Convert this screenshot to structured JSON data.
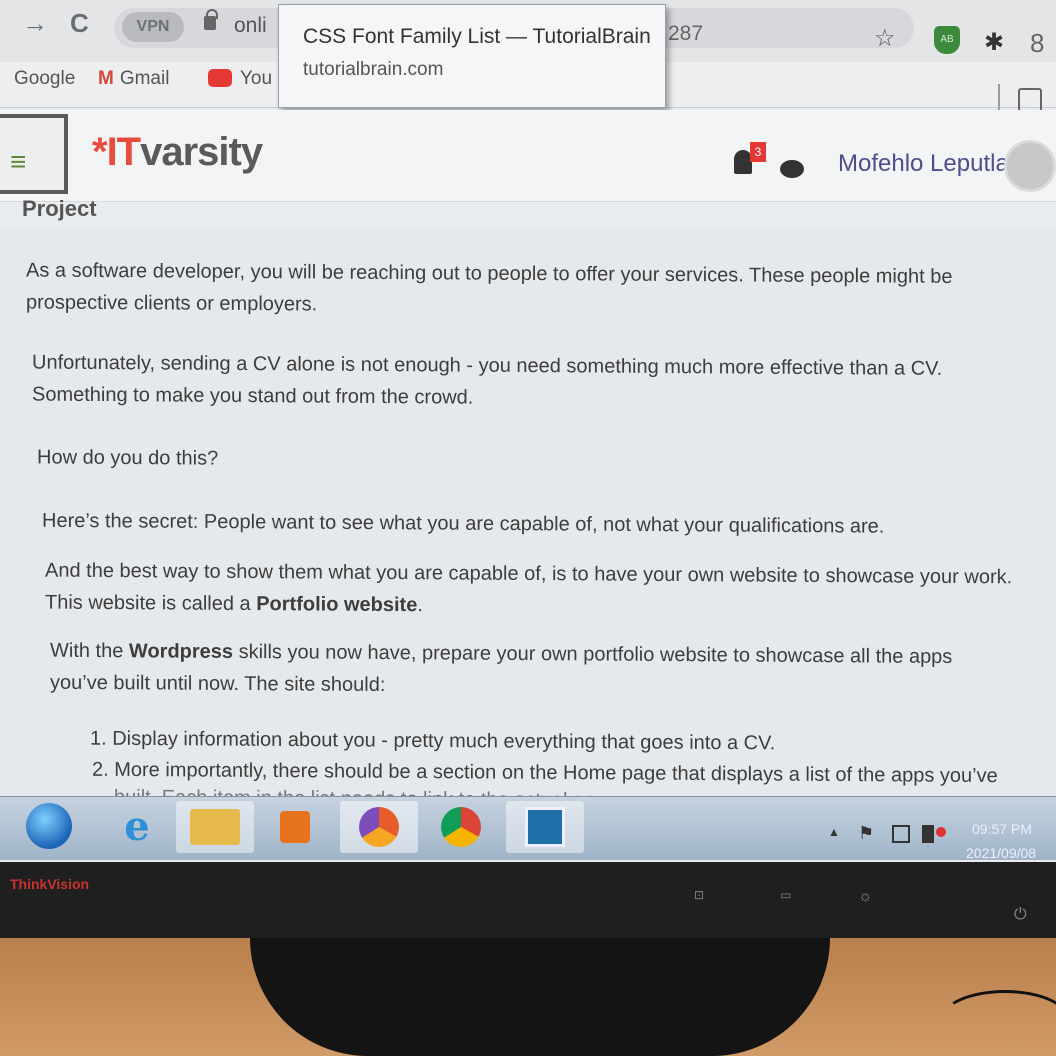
{
  "browser": {
    "vpn_label": "VPN",
    "url_start": "onli",
    "url_end": "287",
    "bookmarks": [
      {
        "label": "Google"
      },
      {
        "label": "Gmail",
        "glyph": "M"
      },
      {
        "label": "You"
      }
    ],
    "extension_badge": "AB"
  },
  "tooltip": {
    "title": "CSS Font Family List — TutorialBrain",
    "url": "tutorialbrain.com"
  },
  "site": {
    "logo_mark": "*IT",
    "logo_word": "varsity",
    "notification_count": "3",
    "user_name": "Mofehlo Leputla",
    "menu_glyph": "≡"
  },
  "page": {
    "title": "Project",
    "p1": "As a software developer, you will be reaching out to people to offer your services. These people might be prospective clients or employers.",
    "p2": "Unfortunately, sending a CV alone is not enough - you need something much more effective than a CV. Something to make you stand out from the crowd.",
    "p3": "How do you do this?",
    "p4": "Here’s the secret: People want to see what you are capable of, not what your qualifications are.",
    "p5_before": "And the best way to show them what you are capable of, is to have your own website to showcase your work. This website is called a ",
    "p5_bold": "Portfolio website",
    "p5_after": ".",
    "p6_before": "With the ",
    "p6_bold": "Wordpress",
    "p6_after": " skills you now have, prepare your own portfolio website to showcase all the  apps you’ve built until now. The site should:",
    "list": [
      "1. Display information about you - pretty much everything that goes into a CV.",
      "2. More importantly, there should be a section on the Home page that displays a list of the apps you’ve",
      "built. Each item in the list needs to link to the actual app."
    ]
  },
  "taskbar": {
    "time": "09:57 PM",
    "date": "2021/09/08"
  },
  "monitor": {
    "brand": "ThinkVision"
  },
  "colors": {
    "logo_accent": "#e74c3c",
    "user_name": "#4b4f8a",
    "notification_badge": "#e53935"
  },
  "icons": [
    "forward-icon",
    "reload-icon",
    "lock-icon",
    "star-icon",
    "puzzle-icon",
    "profile-icon",
    "reading-list-icon",
    "menu-icon",
    "bell-icon",
    "chat-icon",
    "avatar-icon",
    "windows-start-icon",
    "ie-icon",
    "explorer-icon",
    "media-player-icon",
    "chrome-icon"
  ]
}
